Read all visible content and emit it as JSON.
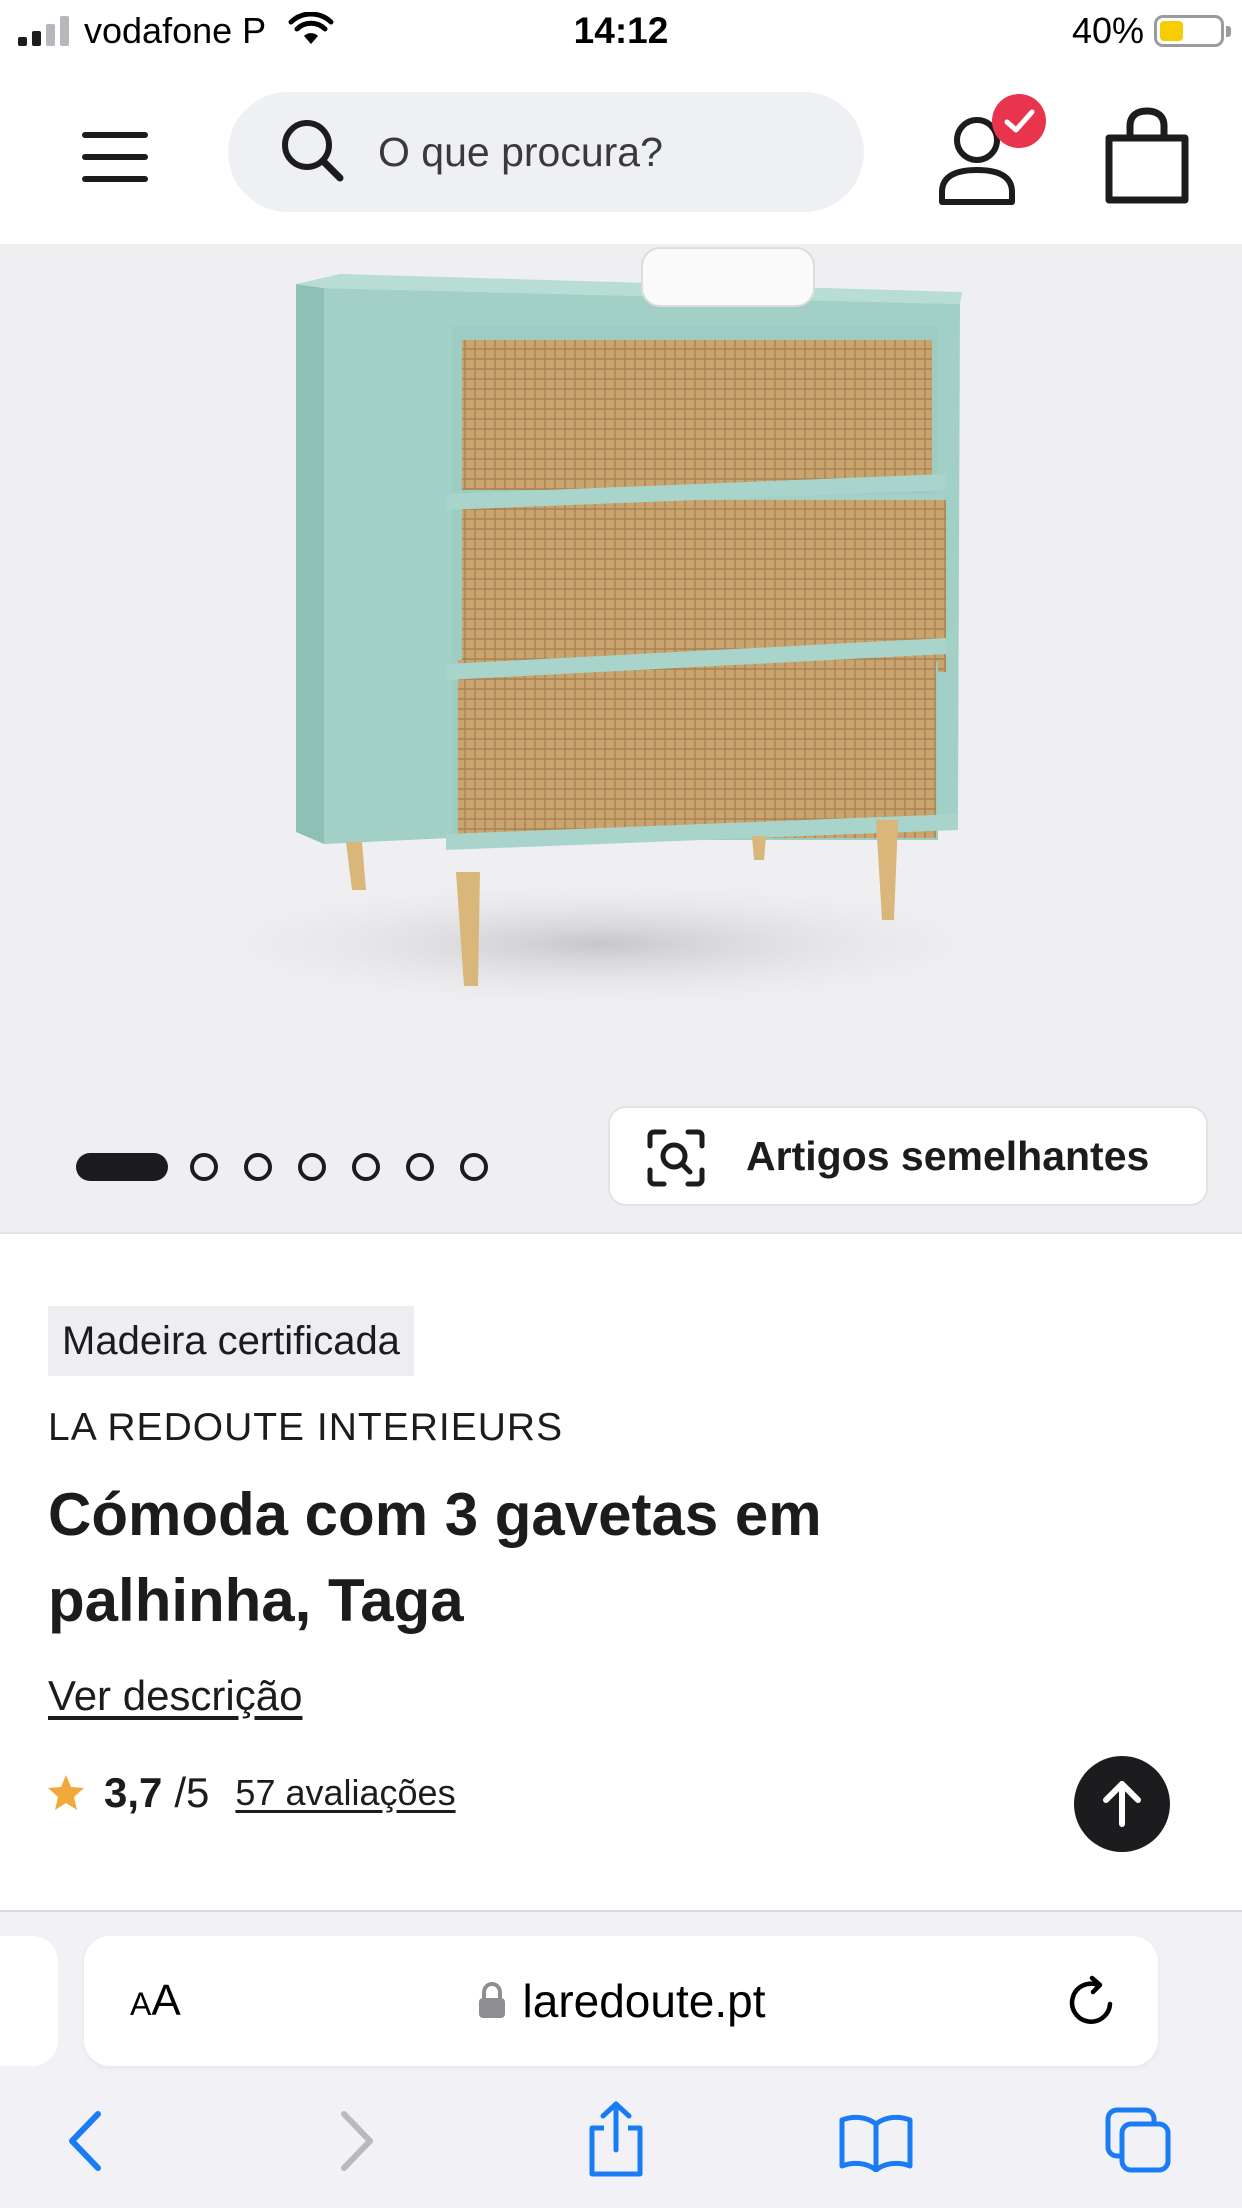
{
  "status_bar": {
    "carrier": "vodafone P",
    "time": "14:12",
    "battery": "40%",
    "battery_level": 0.4,
    "battery_color": "#f7cc00"
  },
  "header": {
    "menu_icon": "hamburger-menu-icon",
    "search_placeholder": "O que procura?",
    "account_icon": "user-icon",
    "account_badge_icon": "checkmark-icon",
    "badge_color": "#e8354d",
    "cart_icon": "shopping-bag-icon"
  },
  "gallery": {
    "image": "Cómoda com 3 gavetas em palhinha",
    "image_count": 7,
    "active_index": 0,
    "similar_label": "Artigos semelhantes",
    "similar_icon": "visual-search-icon"
  },
  "product": {
    "badge": "Madeira certificada",
    "brand": "LA REDOUTE INTERIEURS",
    "title": "Cómoda com 3 gavetas em palhinha, Taga",
    "description_link": "Ver descrição",
    "rating_value": "3,7",
    "rating_max": "/5",
    "reviews_link": "57 avaliações",
    "star_color": "#f2a93b",
    "scroll_top_icon": "arrow-up-icon"
  },
  "browser": {
    "text_size_small": "A",
    "text_size_big": "A",
    "url": "laredoute.pt",
    "lock_icon": "lock-icon",
    "reload_icon": "reload-icon",
    "accent": "#1a7cf5",
    "toolbar": [
      "back-icon",
      "forward-icon",
      "share-icon",
      "bookmarks-icon",
      "tabs-icon"
    ]
  }
}
